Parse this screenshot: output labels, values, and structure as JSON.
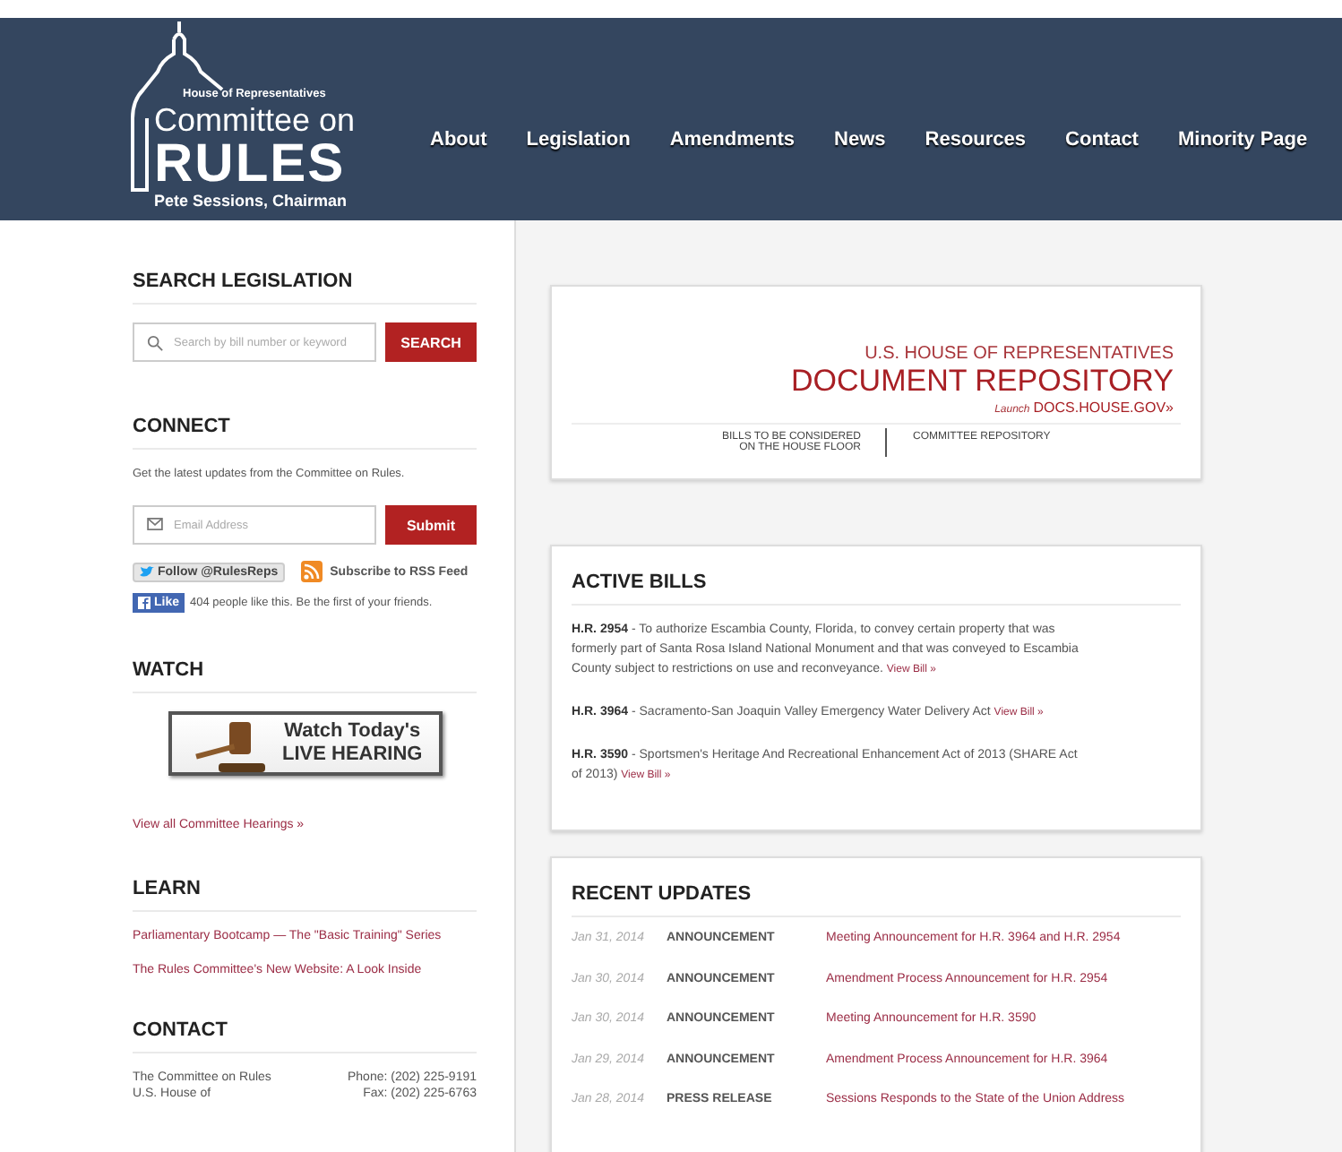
{
  "header": {
    "logo": {
      "overline": "House of Representatives",
      "line1": "Committee on",
      "line2": "RULES",
      "chairman": "Pete Sessions, Chairman"
    },
    "nav": [
      "About",
      "Legislation",
      "Amendments",
      "News",
      "Resources",
      "Contact",
      "Minority Page"
    ]
  },
  "sidebar": {
    "search": {
      "heading": "SEARCH LEGISLATION",
      "placeholder": "Search by bill number or keyword",
      "button": "SEARCH"
    },
    "connect": {
      "heading": "CONNECT",
      "text": "Get the latest updates from the Committee on Rules.",
      "placeholder": "Email Address",
      "button": "Submit",
      "twitter": "Follow @RulesReps",
      "rss": "Subscribe to RSS Feed",
      "like": "Like",
      "like_text": "404 people like this. Be the first of your friends."
    },
    "watch": {
      "heading": "WATCH",
      "banner_line1": "Watch Today's",
      "banner_line2": "LIVE HEARING",
      "link": "View all Committee Hearings »"
    },
    "learn": {
      "heading": "LEARN",
      "links": [
        "Parliamentary Bootcamp — The \"Basic Training\" Series",
        "The Rules Committee's New Website: A Look Inside"
      ]
    },
    "contact": {
      "heading": "CONTACT",
      "address": [
        "The Committee on Rules",
        "U.S. House of"
      ],
      "phones": [
        "Phone: (202) 225-9191",
        "Fax: (202) 225-6763"
      ]
    }
  },
  "repository": {
    "overline": "U.S. HOUSE OF REPRESENTATIVES",
    "title": "DOCUMENT REPOSITORY",
    "launch_prefix": "Launch",
    "launch_link": "DOCS.HOUSE.GOV»",
    "links": [
      "BILLS TO BE CONSIDERED\nON THE HOUSE FLOOR",
      "COMMITTEE REPOSITORY"
    ]
  },
  "active_bills": {
    "heading": "ACTIVE BILLS",
    "bills": [
      {
        "text": "**H.R. 2954** - To authorize Escambia County, Florida, to convey certain property that was formerly part of Santa Rosa Island National Monument and that was conveyed to Escambia County subject to restrictions on use and reconveyance.",
        "link": "View Bill »"
      },
      {
        "text": "**H.R. 3964** - Sacramento-San Joaquin Valley Emergency Water Delivery Act",
        "link": "View Bill »"
      },
      {
        "text": "**H.R. 3590** - Sportsmen's Heritage And Recreational Enhancement Act of 2013 (SHARE Act of 2013)",
        "link": "View Bill »"
      }
    ]
  },
  "recent_updates": {
    "heading": "RECENT UPDATES",
    "rows": [
      {
        "date": "Jan 31, 2014",
        "type": "ANNOUNCEMENT",
        "title": "Meeting Announcement for H.R. 3964 and H.R. 2954"
      },
      {
        "date": "Jan 30, 2014",
        "type": "ANNOUNCEMENT",
        "title": "Amendment Process Announcement for H.R. 2954"
      },
      {
        "date": "Jan 30, 2014",
        "type": "ANNOUNCEMENT",
        "title": "Meeting Announcement for H.R. 3590"
      },
      {
        "date": "Jan 29, 2014",
        "type": "ANNOUNCEMENT",
        "title": "Amendment Process Announcement for H.R. 3964"
      },
      {
        "date": "Jan 28, 2014",
        "type": "PRESS RELEASE",
        "title": "Sessions Responds to the State of the Union Address"
      }
    ]
  }
}
